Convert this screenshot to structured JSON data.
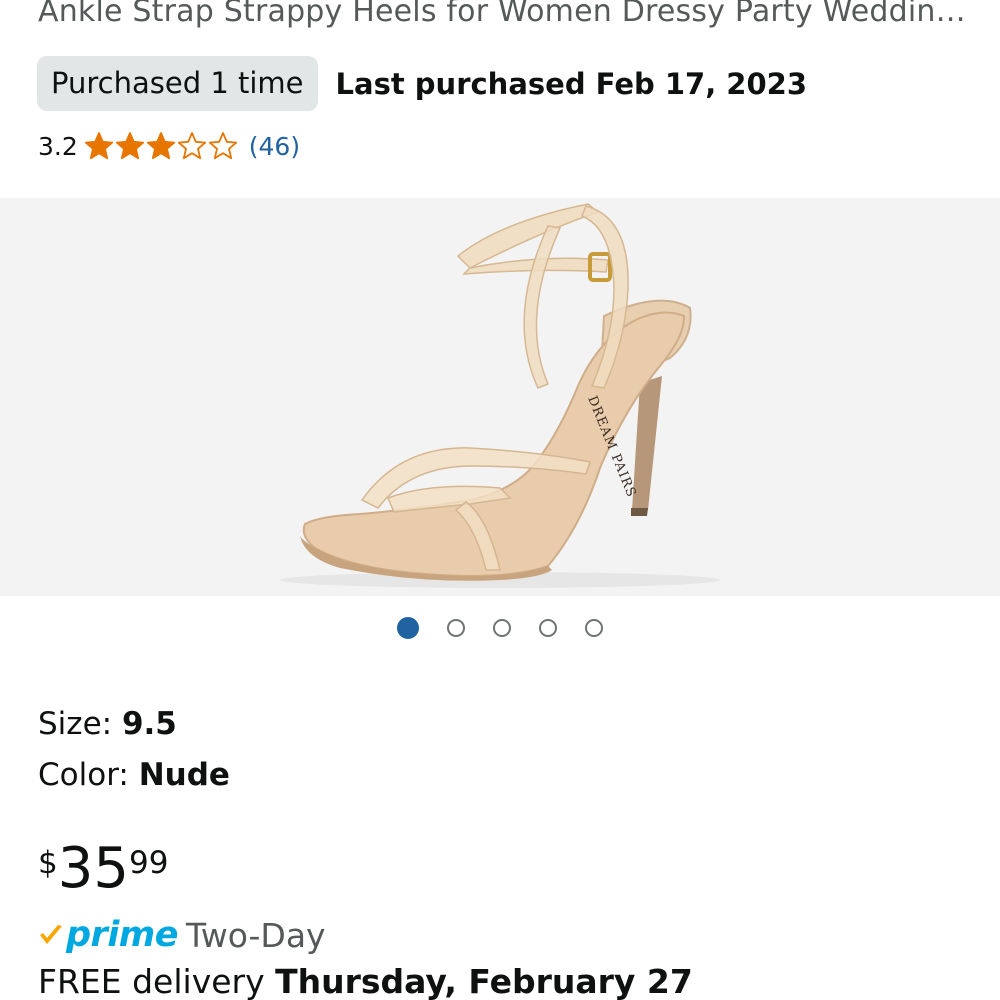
{
  "product": {
    "title": "Ankle Strap Strappy Heels for Women Dressy Party Weddin…",
    "purchase_badge": "Purchased 1 time",
    "last_purchased": "Last purchased Feb 17, 2023",
    "rating_value": "3.2",
    "rating_fraction": 0.64,
    "stars_filled": 3,
    "stars_total": 5,
    "review_count": "(46)",
    "image_brand_text": "DREAM PAIRS",
    "carousel": {
      "total": 5,
      "active_index": 0
    },
    "variations": {
      "size_label": "Size: ",
      "size_value": "9.5",
      "color_label": "Color: ",
      "color_value": "Nude"
    },
    "price": {
      "symbol": "$",
      "whole": "35",
      "fraction": "99"
    },
    "prime": {
      "word": "prime",
      "type": "Two-Day"
    },
    "delivery": {
      "prefix": "FREE delivery ",
      "date": "Thursday, February 27"
    }
  },
  "colors": {
    "star": "#e77600",
    "link": "#2162a1",
    "prime_blue": "#00a8e1",
    "prime_check": "#f7a600",
    "badge_bg": "#e3e6e6"
  },
  "icons": {
    "star_filled": "star-filled-icon",
    "star_empty": "star-empty-icon",
    "prime_check": "prime-check-icon"
  }
}
